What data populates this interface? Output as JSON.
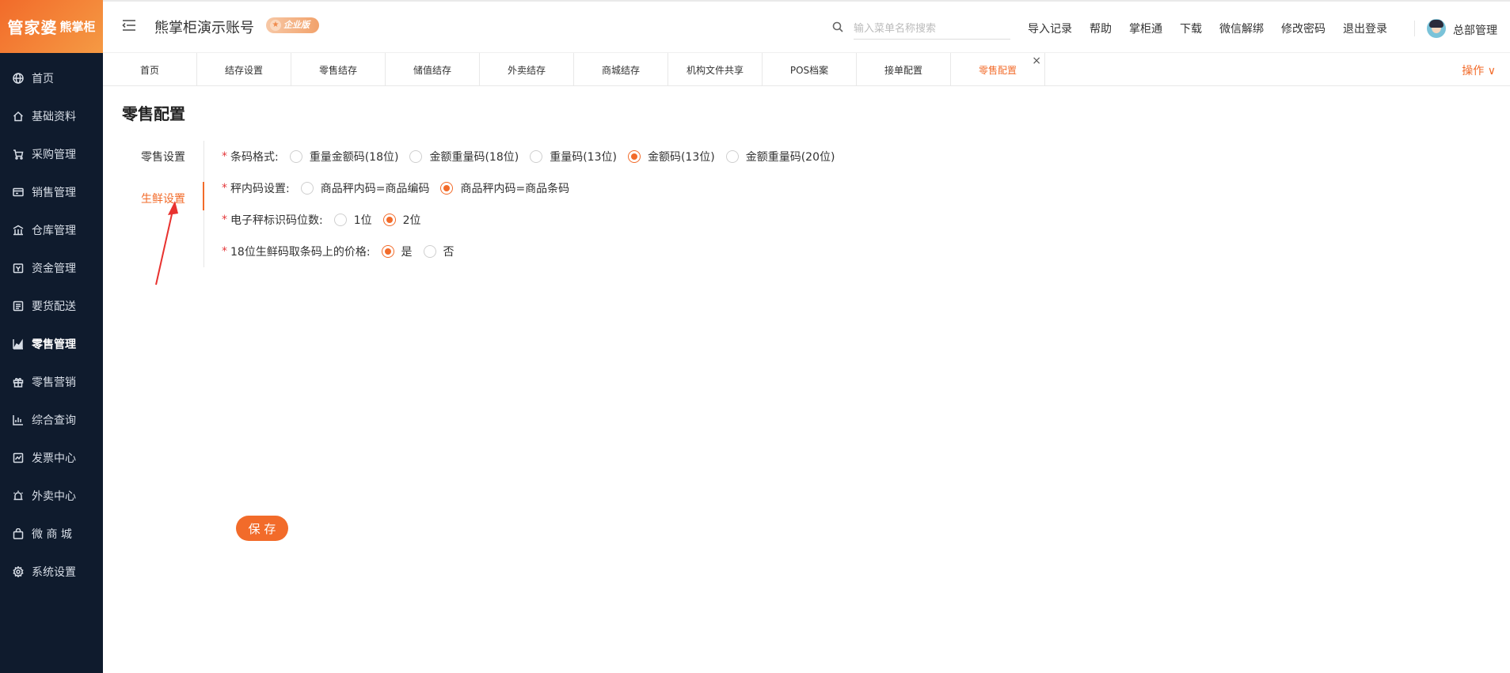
{
  "logo": {
    "brand": "管家婆",
    "sub": "熊掌柜"
  },
  "sidebar": {
    "items": [
      {
        "label": "首页",
        "icon": "globe-icon"
      },
      {
        "label": "基础资料",
        "icon": "home-icon"
      },
      {
        "label": "采购管理",
        "icon": "cart-icon"
      },
      {
        "label": "销售管理",
        "icon": "sales-icon"
      },
      {
        "label": "仓库管理",
        "icon": "warehouse-icon"
      },
      {
        "label": "资金管理",
        "icon": "finance-icon"
      },
      {
        "label": "要货配送",
        "icon": "delivery-icon"
      },
      {
        "label": "零售管理",
        "icon": "chart-area-icon"
      },
      {
        "label": "零售营销",
        "icon": "gift-icon"
      },
      {
        "label": "综合查询",
        "icon": "bar-chart-icon"
      },
      {
        "label": "发票中心",
        "icon": "invoice-icon"
      },
      {
        "label": "外卖中心",
        "icon": "alarm-icon"
      },
      {
        "label": "微 商 城",
        "icon": "bag-icon"
      },
      {
        "label": "系统设置",
        "icon": "gear-icon"
      }
    ],
    "active_label": "零售管理"
  },
  "header": {
    "account_name": "熊掌柜演示账号",
    "edition_badge": "企业版",
    "search_placeholder": "输入菜单名称搜索",
    "links": [
      "导入记录",
      "帮助",
      "掌柜通",
      "下载",
      "微信解绑",
      "修改密码",
      "退出登录"
    ],
    "user_name": "总部管理"
  },
  "tabs": {
    "items": [
      "首页",
      "结存设置",
      "零售结存",
      "储值结存",
      "外卖结存",
      "商城结存",
      "机构文件共享",
      "POS档案",
      "接单配置",
      "零售配置"
    ],
    "active": "零售配置",
    "close_symbol": "×",
    "ops_label": "操作 ∨"
  },
  "page": {
    "title": "零售配置",
    "settings_tabs": [
      "零售设置",
      "生鲜设置"
    ],
    "active_settings_tab": "生鲜设置",
    "required_mark": "*",
    "form": [
      {
        "label": "条码格式:",
        "options": [
          "重量金额码(18位)",
          "金额重量码(18位)",
          "重量码(13位)",
          "金额码(13位)",
          "金额重量码(20位)"
        ],
        "selected": "金额码(13位)"
      },
      {
        "label": "秤内码设置:",
        "options": [
          "商品秤内码=商品编码",
          "商品秤内码=商品条码"
        ],
        "selected": "商品秤内码=商品条码"
      },
      {
        "label": "电子秤标识码位数:",
        "options": [
          "1位",
          "2位"
        ],
        "selected": "2位"
      },
      {
        "label": "18位生鲜码取条码上的价格:",
        "options": [
          "是",
          "否"
        ],
        "selected": "是"
      }
    ],
    "save_label": "保 存"
  },
  "colors": {
    "accent": "#f26b2a",
    "sidebar_bg": "#0f1b2d",
    "required": "#e4393c"
  }
}
